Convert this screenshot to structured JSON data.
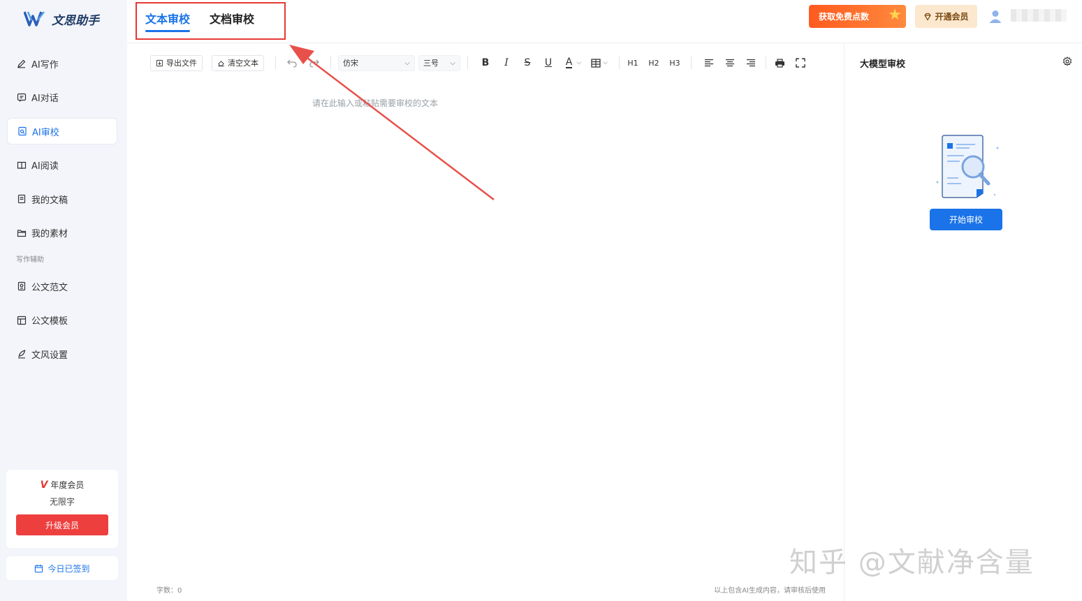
{
  "app": {
    "logo_text": "文思助手",
    "brand_color": "#1a73e8",
    "accent_red": "#e53935"
  },
  "sidebar": {
    "items": [
      {
        "label": "AI写作",
        "icon": "pen-icon",
        "active": false
      },
      {
        "label": "AI对话",
        "icon": "chat-icon",
        "active": false
      },
      {
        "label": "AI审校",
        "icon": "doc-search-icon",
        "active": true
      },
      {
        "label": "AI阅读",
        "icon": "book-icon",
        "active": false
      },
      {
        "label": "我的文稿",
        "icon": "document-icon",
        "active": false
      },
      {
        "label": "我的素材",
        "icon": "folder-icon",
        "active": false
      }
    ],
    "section_label": "写作辅助",
    "aux_items": [
      {
        "label": "公文范文",
        "icon": "sample-doc-icon"
      },
      {
        "label": "公文模板",
        "icon": "template-icon"
      },
      {
        "label": "文风设置",
        "icon": "feather-icon"
      }
    ],
    "vip_card": {
      "plan": "年度会员",
      "quota": "无限字",
      "upgrade_label": "升级会员"
    },
    "signin_label": "今日已签到"
  },
  "header": {
    "tabs": [
      {
        "label": "文本审校",
        "active": true
      },
      {
        "label": "文档审校",
        "active": false
      }
    ],
    "free_points_label": "获取免费点数",
    "open_vip_label": "开通会员"
  },
  "editor": {
    "toolbar": {
      "export_label": "导出文件",
      "clear_label": "清空文本",
      "font_value": "仿宋",
      "size_value": "三号",
      "heading_labels": [
        "H1",
        "H2",
        "H3"
      ]
    },
    "placeholder": "请在此输入或粘贴需要审校的文本",
    "word_count": "字数：0",
    "disclaimer": "以上包含AI生成内容，请审核后使用"
  },
  "right_panel": {
    "title": "大模型审校",
    "start_label": "开始审校"
  },
  "watermark": "知乎 @文献净含量"
}
